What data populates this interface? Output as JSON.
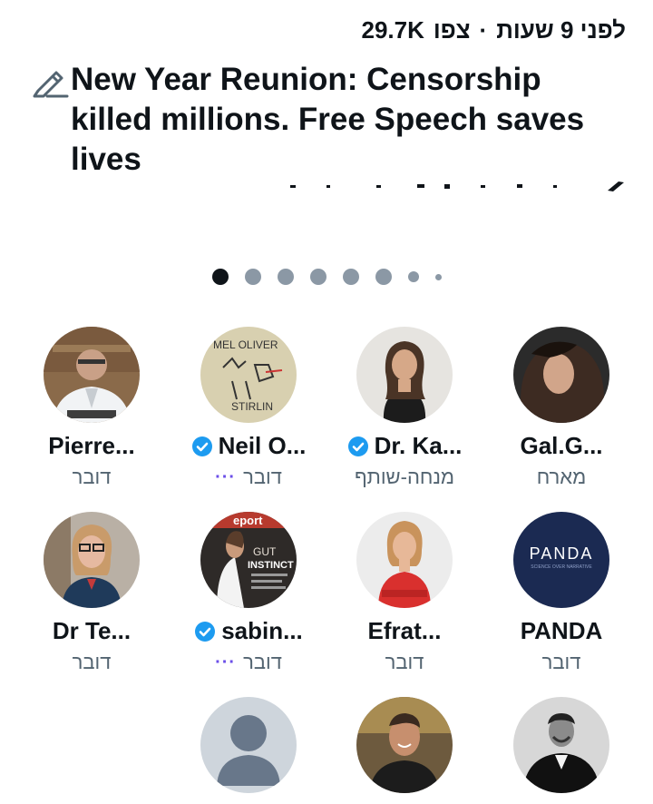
{
  "header": {
    "views": "29.7K",
    "views_label": "צפו",
    "separator": "·",
    "time_ago": "לפני 9 שעות"
  },
  "space": {
    "title": "New Year Reunion: Censorship killed millions. Free Speech saves lives",
    "edit_icon": "pencil-edit-icon"
  },
  "carousel": {
    "dot_count": 8,
    "active_index": 0
  },
  "participants": [
    {
      "name": "Pierre...",
      "role": "דובר",
      "verified": false,
      "more": false
    },
    {
      "name": "Neil O...",
      "role": "דובר",
      "verified": true,
      "more": true
    },
    {
      "name": "Dr. Ka...",
      "role": "מנחה-שותף",
      "verified": true,
      "more": false
    },
    {
      "name": "Gal.G...",
      "role": "מארח",
      "verified": false,
      "more": false
    },
    {
      "name": "Dr Te...",
      "role": "דובר",
      "verified": false,
      "more": false
    },
    {
      "name": "sabin...",
      "role": "דובר",
      "verified": true,
      "more": true
    },
    {
      "name": "Efrat...",
      "role": "דובר",
      "verified": false,
      "more": false
    },
    {
      "name": "PANDA",
      "role": "דובר",
      "verified": false,
      "more": false
    }
  ],
  "avatar_text": {
    "neil_sign_line1": "MEL OLIVER",
    "neil_sign_line2": "STIRLIN",
    "sabine_magazine": "eport",
    "sabine_cover1": "GUT",
    "sabine_cover2": "INSTINCT",
    "panda_logo": "PANDA",
    "panda_tagline": "SCIENCE OVER NARRATIVE"
  },
  "colors": {
    "text": "#0f1419",
    "secondary": "#536471",
    "verified": "#1d9bf0",
    "dot_inactive": "#8b98a5",
    "more": "#6a4ee8"
  }
}
